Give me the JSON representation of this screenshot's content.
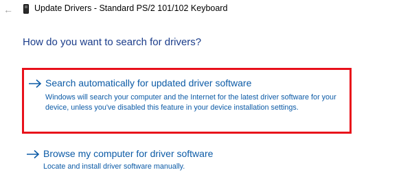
{
  "window": {
    "title": "Update Drivers - Standard PS/2 101/102 Keyboard",
    "back_icon": "back-arrow-icon",
    "device_icon": "keyboard-device-icon"
  },
  "main": {
    "heading": "How do you want to search for drivers?",
    "options": [
      {
        "title": "Search automatically for updated driver software",
        "description": "Windows will search your computer and the Internet for the latest driver software for your device, unless you've disabled this feature in your device installation settings.",
        "highlighted": true
      },
      {
        "title": "Browse my computer for driver software",
        "description": "Locate and install driver software manually.",
        "highlighted": false
      }
    ]
  },
  "colors": {
    "link_blue": "#0b5aa6",
    "heading_blue": "#1a3c8a",
    "highlight_red": "#e8101a"
  }
}
